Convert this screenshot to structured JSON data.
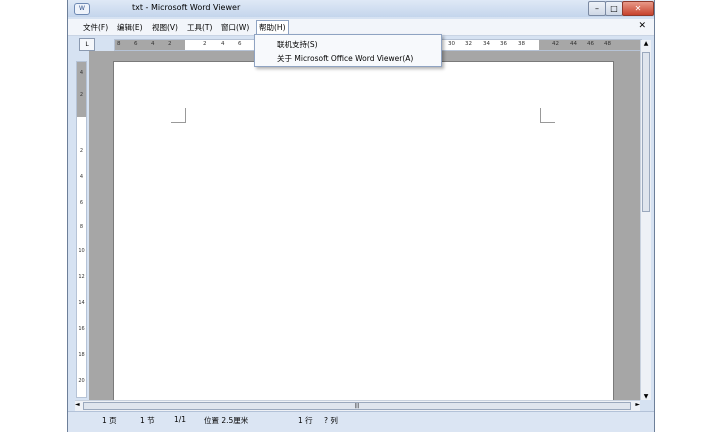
{
  "window": {
    "title": "txt - Microsoft Word Viewer",
    "app_icon": "W",
    "controls": {
      "minimize": "–",
      "maximize": "□",
      "close": "✕"
    }
  },
  "menubar": {
    "items": [
      {
        "label": "文件(F)"
      },
      {
        "label": "编辑(E)"
      },
      {
        "label": "视图(V)"
      },
      {
        "label": "工具(T)"
      },
      {
        "label": "窗口(W)"
      },
      {
        "label": "帮助(H)"
      }
    ],
    "doc_close": "✕"
  },
  "help_menu": {
    "items": [
      {
        "label": "联机支持(S)"
      },
      {
        "label": "关于 Microsoft Office Word Viewer(A)"
      }
    ]
  },
  "ruler": {
    "corner": "L",
    "h_left": [
      "8",
      "6",
      "4",
      "2",
      "2",
      "4",
      "6"
    ],
    "h_right": [
      "30",
      "32",
      "34",
      "36",
      "38",
      "42",
      "44",
      "46",
      "48"
    ],
    "v_labels": [
      "4",
      "2",
      "2",
      "4",
      "6",
      "8",
      "10",
      "12",
      "14",
      "16",
      "18",
      "20"
    ]
  },
  "scrollbars": {
    "up": "▲",
    "down": "▼",
    "left": "◄",
    "right": "►",
    "grip": "|||"
  },
  "statusbar": {
    "page": "1 页",
    "section": "1 节",
    "page_count": "1/1",
    "position": "位置 2.5厘米",
    "line": "1 行",
    "column": "? 列"
  }
}
